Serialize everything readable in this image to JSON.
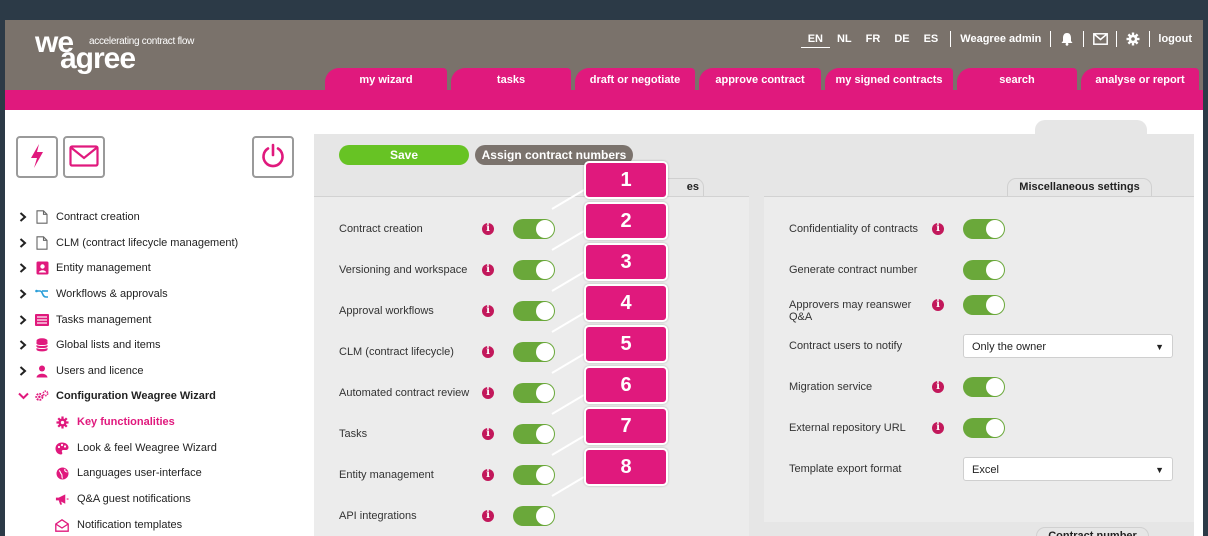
{
  "header": {
    "logo_top": "we",
    "logo_bottom": "agree",
    "tagline": "accelerating contract flow",
    "languages": [
      "EN",
      "NL",
      "FR",
      "DE",
      "ES"
    ],
    "active_language": "EN",
    "user": "Weagree admin",
    "logout": "logout",
    "icons": [
      "bell-icon",
      "mail-icon",
      "gear-icon"
    ]
  },
  "nav_tabs": [
    "my wizard",
    "tasks",
    "draft or negotiate",
    "approve contract",
    "my signed contracts",
    "search",
    "analyse or report"
  ],
  "sidebar": {
    "tool_icons": [
      "lightning-icon",
      "envelope-icon",
      "power-icon"
    ],
    "items": [
      {
        "label": "Contract creation",
        "icon": "document-icon"
      },
      {
        "label": "CLM (contract lifecycle management)",
        "icon": "document-icon"
      },
      {
        "label": "Entity management",
        "icon": "id-card-icon"
      },
      {
        "label": "Workflows & approvals",
        "icon": "workflow-icon"
      },
      {
        "label": "Tasks management",
        "icon": "tasks-icon"
      },
      {
        "label": "Global lists and items",
        "icon": "database-icon"
      },
      {
        "label": "Users and licence",
        "icon": "user-icon"
      },
      {
        "label": "Configuration Weagree Wizard",
        "icon": "gears-icon",
        "expanded": true
      }
    ],
    "sub_items": [
      {
        "label": "Key functionalities",
        "icon": "gear-icon",
        "active": true
      },
      {
        "label": "Look & feel Weagree Wizard",
        "icon": "palette-icon"
      },
      {
        "label": "Languages user-interface",
        "icon": "globe-icon"
      },
      {
        "label": "Q&A guest notifications",
        "icon": "megaphone-icon"
      },
      {
        "label": "Notification templates",
        "icon": "envelope-open-icon"
      }
    ]
  },
  "main": {
    "save_label": "Save",
    "assign_label": "Assign contract numbers",
    "left_panel": {
      "title_fragment": "es",
      "rows": [
        {
          "label": "Contract creation",
          "enabled": true
        },
        {
          "label": "Versioning and workspace",
          "enabled": true
        },
        {
          "label": "Approval workflows",
          "enabled": true
        },
        {
          "label": "CLM (contract lifecycle)",
          "enabled": true
        },
        {
          "label": "Automated contract review",
          "enabled": true
        },
        {
          "label": "Tasks",
          "enabled": true
        },
        {
          "label": "Entity management",
          "enabled": true
        },
        {
          "label": "API integrations",
          "enabled": true
        }
      ]
    },
    "right_panel": {
      "title": "Miscellaneous settings",
      "rows": [
        {
          "label": "Confidentiality of contracts",
          "info": true,
          "type": "toggle",
          "enabled": true
        },
        {
          "label": "Generate contract number",
          "info": false,
          "type": "toggle",
          "enabled": true
        },
        {
          "label": "Approvers may reanswer Q&A",
          "info": true,
          "type": "toggle",
          "enabled": true
        },
        {
          "label": "Contract users to notify",
          "info": false,
          "type": "select",
          "value": "Only the owner"
        },
        {
          "label": "Migration service",
          "info": true,
          "type": "toggle",
          "enabled": true
        },
        {
          "label": "External repository URL",
          "info": true,
          "type": "toggle",
          "enabled": true
        },
        {
          "label": "Template export format",
          "info": false,
          "type": "select",
          "value": "Excel"
        }
      ]
    },
    "contract_number_title": "Contract number"
  },
  "callouts": [
    "1",
    "2",
    "3",
    "4",
    "5",
    "6",
    "7",
    "8"
  ],
  "colors": {
    "brand_pink": "#e0197d",
    "header_grey": "#7a726b",
    "toggle_green": "#6aa83a",
    "save_green": "#67c324"
  }
}
